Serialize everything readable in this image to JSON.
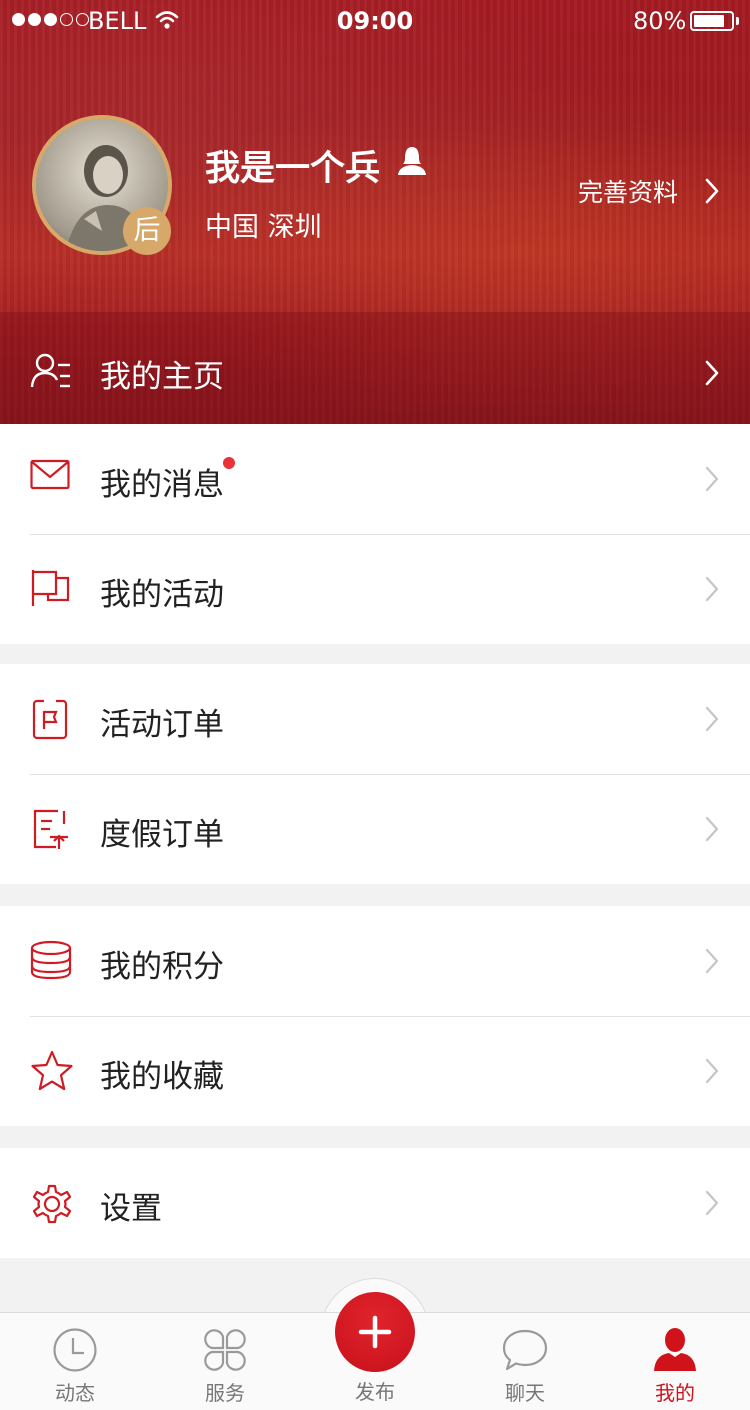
{
  "status_bar": {
    "carrier": "BELL",
    "time": "09:00",
    "battery": "80%"
  },
  "profile": {
    "nickname": "我是一个兵",
    "location": "中国 深圳",
    "avatar_badge": "后",
    "edit_label": "完善资料",
    "home_label": "我的主页"
  },
  "menu": {
    "messages": "我的消息",
    "activities": "我的活动",
    "activity_orders": "活动订单",
    "vacation_orders": "度假订单",
    "points": "我的积分",
    "favorites": "我的收藏",
    "settings": "设置"
  },
  "tabs": {
    "feed": "动态",
    "services": "服务",
    "publish": "发布",
    "chat": "聊天",
    "mine": "我的"
  },
  "colors": {
    "brand_red": "#d0121b",
    "header_red": "#a41a22",
    "badge_gold": "#d6a86a",
    "unread_dot": "#e63238"
  },
  "icons": [
    "wifi-icon",
    "female-user-icon",
    "person-list-icon",
    "mail-icon",
    "flag-icon",
    "clipboard-flag-icon",
    "document-upload-icon",
    "coins-stack-icon",
    "star-icon",
    "gear-icon",
    "clock-icon",
    "four-petal-icon",
    "plus-icon",
    "chat-bubble-icon",
    "person-icon",
    "chevron-right-icon"
  ]
}
